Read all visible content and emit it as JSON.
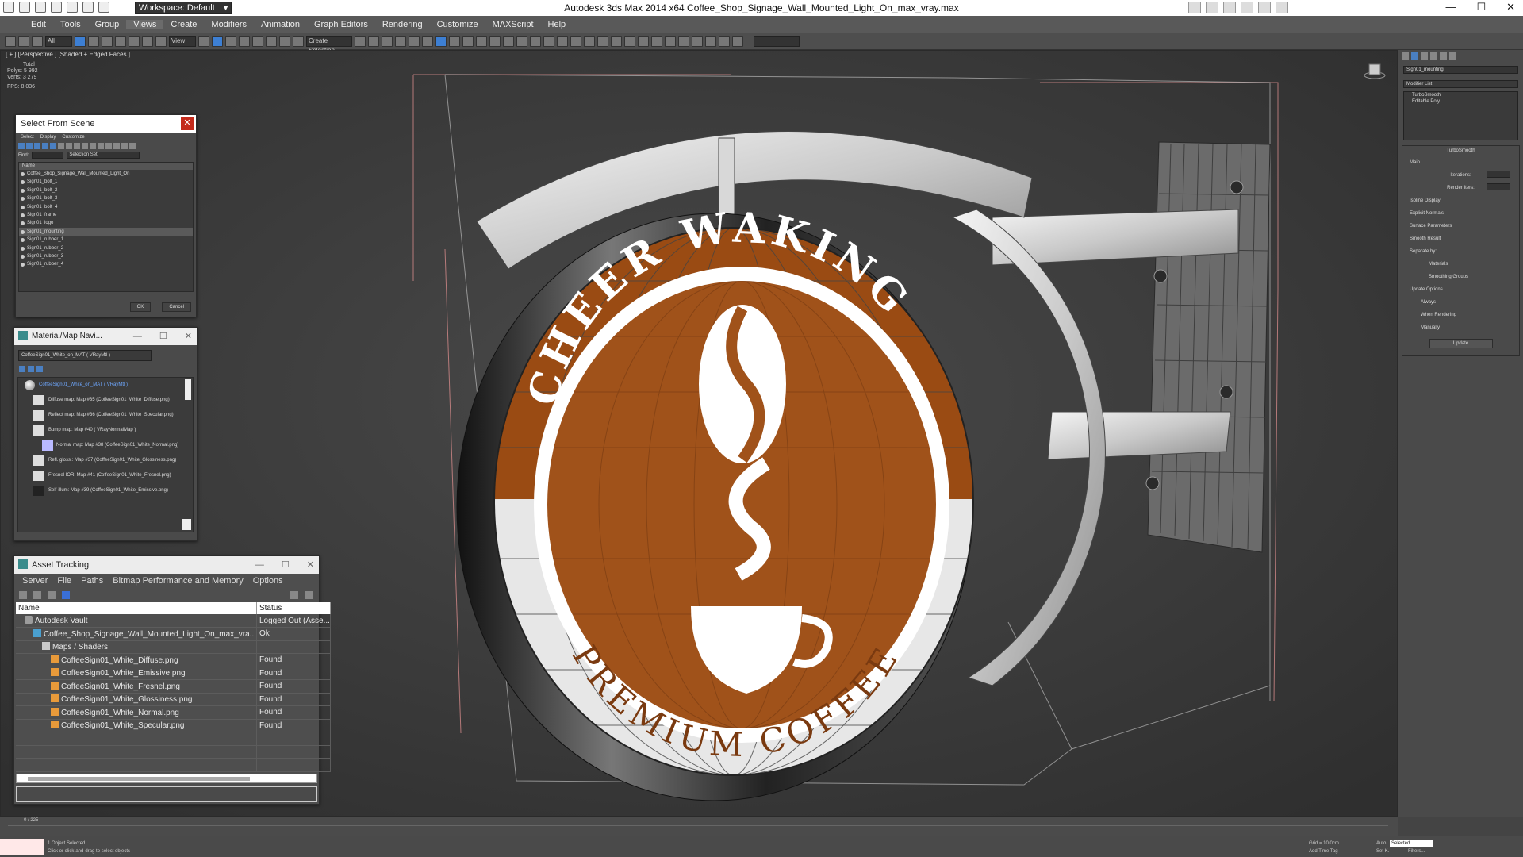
{
  "titlebar": {
    "workspace": "Workspace: Default",
    "title": "Autodesk 3ds Max  2014 x64     Coffee_Shop_Signage_Wall_Mounted_Light_On_max_vray.max",
    "minimize": "—",
    "maximize": "☐",
    "close": "✕"
  },
  "menu": [
    "Edit",
    "Tools",
    "Group",
    "Views",
    "Create",
    "Modifiers",
    "Animation",
    "Graph Editors",
    "Rendering",
    "Customize",
    "MAXScript",
    "Help"
  ],
  "toolbar": {
    "selection_filter": "All",
    "view": "View",
    "create_selection": "Create Selection"
  },
  "viewport": {
    "label": "[ + ] [Perspective ] [Shaded + Edged Faces ]",
    "stats": {
      "total_label": "Total",
      "polys": "Polys:  5 992",
      "verts": "Verts:  3 279",
      "fps": "FPS:     8.036"
    }
  },
  "sign": {
    "top_text": "CHEER WAKING",
    "bottom_text": "PREMIUM COFFEE"
  },
  "select_from_scene": {
    "title": "Select From Scene",
    "menus": [
      "Select",
      "Display",
      "Customize"
    ],
    "find_label": "Find:",
    "selection_set": "Selection Set:",
    "column": "Name",
    "items": [
      "Coffee_Shop_Signage_Wall_Mounted_Light_On",
      "Sign01_bolt_1",
      "Sign01_bolt_2",
      "Sign01_bolt_3",
      "Sign01_bolt_4",
      "Sign01_frame",
      "Sign01_logo",
      "Sign01_mounting",
      "Sign01_rubber_1",
      "Sign01_rubber_2",
      "Sign01_rubber_3",
      "Sign01_rubber_4"
    ],
    "selected_index": 7,
    "ok": "OK",
    "cancel": "Cancel"
  },
  "material_navigator": {
    "title": "Material/Map Navi...",
    "material_field": "CoffeeSign01_White_on_MAT  ( VRayMtl )",
    "root": "CoffeeSign01_White_on_MAT  ( VRayMtl )",
    "maps": [
      "Diffuse map: Map #35 (CoffeeSign01_White_Diffuse.png)",
      "Reflect map: Map #36 (CoffeeSign01_White_Specular.png)",
      "Bump map: Map #40  ( VRayNormalMap )",
      "Normal map: Map #38 (CoffeeSign01_White_Normal.png)",
      "Refl. gloss.: Map #37 (CoffeeSign01_White_Glossiness.png)",
      "Fresnel IOR: Map #41 (CoffeeSign01_White_Fresnel.png)",
      "Self-illum: Map #39 (CoffeeSign01_White_Emissive.png)"
    ]
  },
  "asset_tracking": {
    "title": "Asset Tracking",
    "menus": [
      "Server",
      "File",
      "Paths",
      "Bitmap Performance and Memory",
      "Options"
    ],
    "columns": [
      "Name",
      "Status"
    ],
    "rows": [
      {
        "name": "Autodesk Vault",
        "status": "Logged Out (Asse...",
        "icon": "vault",
        "indent": 1
      },
      {
        "name": "Coffee_Shop_Signage_Wall_Mounted_Light_On_max_vra...",
        "status": "Ok",
        "icon": "file",
        "indent": 2
      },
      {
        "name": "Maps / Shaders",
        "status": "",
        "icon": "folder",
        "indent": 3
      },
      {
        "name": "CoffeeSign01_White_Diffuse.png",
        "status": "Found",
        "icon": "img",
        "indent": 4
      },
      {
        "name": "CoffeeSign01_White_Emissive.png",
        "status": "Found",
        "icon": "img",
        "indent": 4
      },
      {
        "name": "CoffeeSign01_White_Fresnel.png",
        "status": "Found",
        "icon": "img",
        "indent": 4
      },
      {
        "name": "CoffeeSign01_White_Glossiness.png",
        "status": "Found",
        "icon": "img",
        "indent": 4
      },
      {
        "name": "CoffeeSign01_White_Normal.png",
        "status": "Found",
        "icon": "img",
        "indent": 4
      },
      {
        "name": "CoffeeSign01_White_Specular.png",
        "status": "Found",
        "icon": "img",
        "indent": 4
      }
    ]
  },
  "command_panel": {
    "object_name": "Sign01_mounting",
    "modifier_list": "Modifier List",
    "stack": [
      "TurboSmooth",
      "Editable Poly"
    ],
    "turbosmooth": {
      "title": "TurboSmooth",
      "main": "Main",
      "iterations": "Iterations:",
      "render_iters": "Render Iters:",
      "isoline": "Isoline Display",
      "explicit": "Explicit Normals",
      "surface": "Surface Parameters",
      "smooth_result": "Smooth Result",
      "separate": "Separate by:",
      "materials": "Materials",
      "smoothing_groups": "Smoothing Groups",
      "update_options": "Update Options",
      "always": "Always",
      "when_rendering": "When Rendering",
      "manually": "Manually",
      "update": "Update"
    }
  },
  "timeline": {
    "frame": "0 / 225"
  },
  "status": {
    "selected": "1 Object Selected",
    "prompt": "Click or click-and-drag to select objects",
    "grid": "Grid = 10.0cm",
    "auto": "Auto",
    "selected_dd": "Selected",
    "add_time_tag": "Add Time Tag",
    "set_k": "Set K.",
    "filters": "Filters..."
  }
}
